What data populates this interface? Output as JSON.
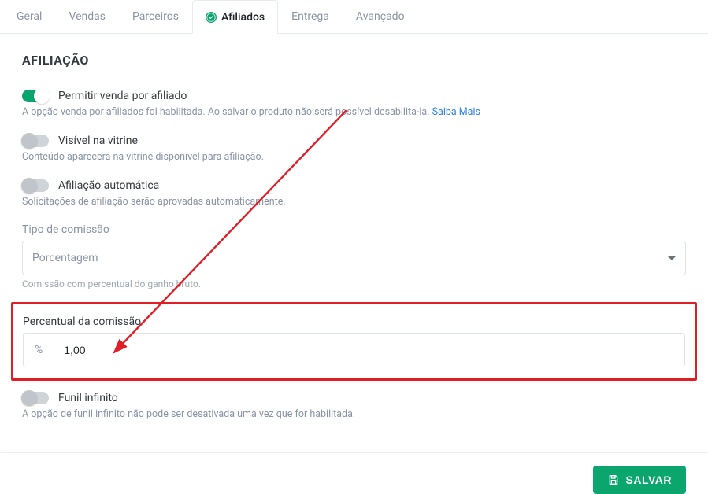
{
  "tabs": {
    "items": [
      {
        "label": "Geral"
      },
      {
        "label": "Vendas"
      },
      {
        "label": "Parceiros"
      },
      {
        "label": "Afiliados"
      },
      {
        "label": "Entrega"
      },
      {
        "label": "Avançado"
      }
    ],
    "active_index": 3
  },
  "page": {
    "title": "AFILIAÇÃO"
  },
  "affiliate": {
    "allow_sale": {
      "label": "Permitir venda por afiliado",
      "enabled": true,
      "hint_prefix": "A opção venda por afiliados foi habilitada. Ao salvar o produto não será possível desabilita-la. ",
      "hint_link": "Saiba Mais"
    },
    "visible_showcase": {
      "label": "Visível na vitrine",
      "enabled": false,
      "hint": "Conteúdo aparecerá na vitrine disponível para afiliação."
    },
    "auto_affiliation": {
      "label": "Afiliação automática",
      "enabled": false,
      "hint": "Solicitações de afiliação serão aprovadas automaticamente."
    },
    "commission_type": {
      "label": "Tipo de comissão",
      "selected": "Porcentagem",
      "hint": "Comissão com percentual do ganho bruto."
    },
    "commission_percent": {
      "label": "Percentual da comissão",
      "prefix": "%",
      "value": "1,00"
    },
    "infinite_funnel": {
      "label": "Funil infinito",
      "enabled": false,
      "hint": "A opção de funil infinito não pode ser desativada uma vez que for habilitada."
    }
  },
  "footer": {
    "save_label": "SALVAR"
  },
  "annotation": {
    "highlight_color": "#e11d26"
  }
}
